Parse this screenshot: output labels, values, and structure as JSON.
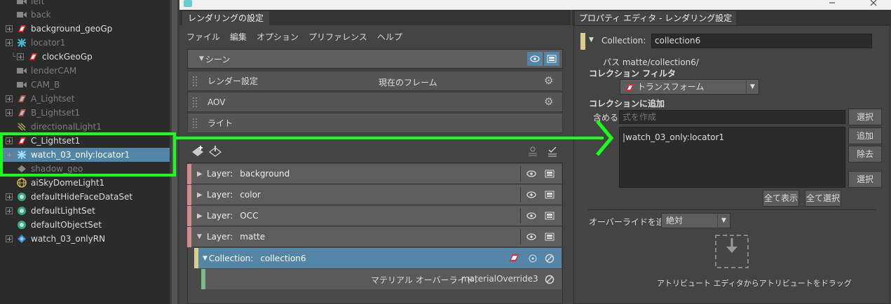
{
  "outliner": {
    "items": [
      {
        "label": "left",
        "dim": true
      },
      {
        "label": "back",
        "dim": true
      },
      {
        "label": "background_geoGp"
      },
      {
        "label": "locator1",
        "dim": true
      },
      {
        "label": "clockGeoGp"
      },
      {
        "label": "lenderCAM",
        "dim": true
      },
      {
        "label": "CAM_B",
        "dim": true
      },
      {
        "label": "A_Lightset",
        "dim": true
      },
      {
        "label": "B_Lightset1",
        "dim": true
      },
      {
        "label": "directionalLight1",
        "dim": true
      },
      {
        "label": "C_Lightset1"
      },
      {
        "label": "watch_03_only:locator1",
        "selected": true
      },
      {
        "label": "shadow_geo",
        "dim": true
      },
      {
        "label": "aiSkyDomeLight1"
      },
      {
        "label": "defaultHideFaceDataSet"
      },
      {
        "label": "defaultLightSet"
      },
      {
        "label": "defaultObjectSet"
      },
      {
        "label": "watch_03_onlyRN"
      }
    ]
  },
  "render_setup": {
    "tab_title": "レンダリングの設定",
    "menu": [
      "ファイル",
      "編集",
      "オプション",
      "プリファレンス",
      "ヘルプ"
    ],
    "scene_label": "シーン",
    "render_settings_label": "レンダー設定",
    "current_frame_label": "現在のフレーム",
    "aov_label": "AOV",
    "lights_label": "ライト",
    "layers": [
      {
        "prefix": "Layer:",
        "name": "background",
        "expanded": false
      },
      {
        "prefix": "Layer:",
        "name": "color",
        "expanded": false
      },
      {
        "prefix": "Layer:",
        "name": "OCC",
        "expanded": false
      },
      {
        "prefix": "Layer:",
        "name": "matte",
        "expanded": true
      }
    ],
    "collection": {
      "prefix": "Collection:",
      "name": "collection6"
    },
    "material_override": {
      "label": "マテリアル オーバーライド:",
      "value": "materialOverride3"
    }
  },
  "property_editor": {
    "tab_title": "プロパティ エディタ - レンダリング設定",
    "collection_label": "Collection:",
    "collection_value": "collection6",
    "path": "パス matte/collection6/",
    "filter_label": "コレクション フィルタ",
    "filter_value": "トランスフォーム",
    "add_label": "コレクションに追加",
    "include_label": "含める",
    "expression_placeholder": "式を作成",
    "select_label": "選択",
    "add_button": "追加",
    "remove_button": "除去",
    "select2_label": "選択",
    "list_items": [
      "|watch_03_only:locator1"
    ],
    "show_all": "全て表示",
    "select_all": "全て選択",
    "override_label": "オーバーライドを追加",
    "override_value": "絶対",
    "drag_hint": "アトリビュート エディタからアトリビュートをドラッグ"
  },
  "colors": {
    "selection": "#5285a6",
    "highlight": "#19ff19",
    "layer_strip": "#d58b8b"
  }
}
